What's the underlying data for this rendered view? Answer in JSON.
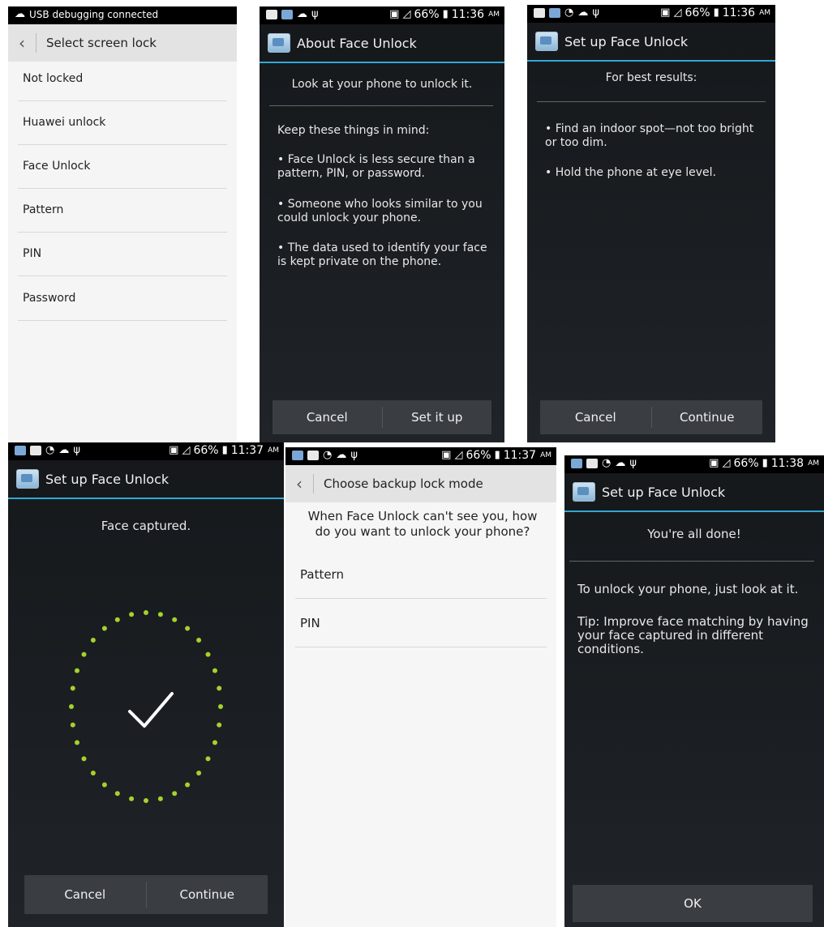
{
  "p1": {
    "status_text": "USB debugging connected",
    "title": "Select screen lock",
    "items": [
      "Not locked",
      "Huawei unlock",
      "Face Unlock",
      "Pattern",
      "PIN",
      "Password"
    ]
  },
  "p2": {
    "time": "11:36",
    "ampm": "AM",
    "battery": "66%",
    "title": "About Face Unlock",
    "heading": "Look at your phone to unlock it.",
    "subheading": "Keep these things in mind:",
    "bullets": [
      "• Face Unlock is less secure than a pattern, PIN, or password.",
      "• Someone who looks similar to you could unlock your phone.",
      "• The data used to identify your face is kept private on the phone."
    ],
    "cancel": "Cancel",
    "action": "Set it up"
  },
  "p3": {
    "time": "11:36",
    "ampm": "AM",
    "battery": "66%",
    "title": "Set up Face Unlock",
    "heading": "For best results:",
    "bullets": [
      "• Find an indoor spot—not too bright or too dim.",
      "• Hold the phone at eye level."
    ],
    "cancel": "Cancel",
    "action": "Continue"
  },
  "p4": {
    "time": "11:37",
    "ampm": "AM",
    "battery": "66%",
    "title": "Set up Face Unlock",
    "heading": "Face captured.",
    "cancel": "Cancel",
    "action": "Continue",
    "dot_color": "#a6d22b"
  },
  "p5": {
    "time": "11:37",
    "ampm": "AM",
    "battery": "66%",
    "title": "Choose backup lock mode",
    "prompt": "When Face Unlock can't see you, how do you want to unlock your phone?",
    "items": [
      "Pattern",
      "PIN"
    ]
  },
  "p6": {
    "time": "11:38",
    "ampm": "AM",
    "battery": "66%",
    "title": "Set up Face Unlock",
    "heading": "You're all done!",
    "line1": "To unlock your phone, just look at it.",
    "line2": "Tip: Improve face matching by having your face captured in different conditions.",
    "ok": "OK"
  },
  "accent": "#33a7d6"
}
